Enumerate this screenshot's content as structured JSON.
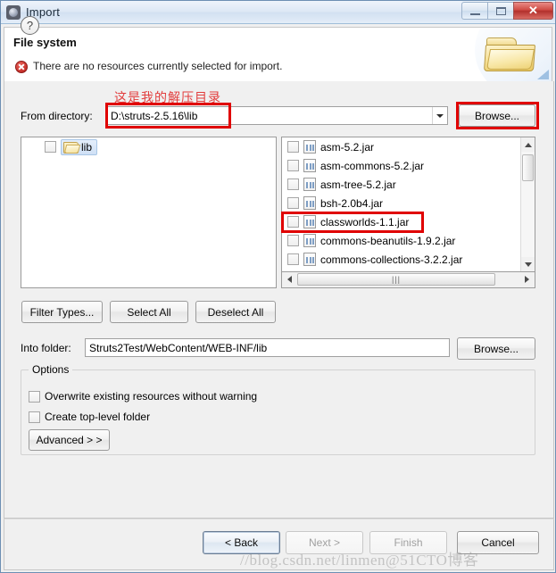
{
  "window": {
    "title": "Import",
    "icon": "import-wizard-icon",
    "controls": {
      "minimize": "minimize",
      "maximize": "maximize",
      "close": "close"
    }
  },
  "header": {
    "title": "File system",
    "message": "There are no resources currently selected for import.",
    "status_icon": "error-icon",
    "banner_icon": "folder-banner-icon"
  },
  "annotation": {
    "note_cn": "这是我的解压目录",
    "note_color": "#e23c3c",
    "highlight_color": "#e00000"
  },
  "source": {
    "label": "From directory:",
    "value": "D:\\struts-2.5.16\\lib",
    "browse_label": "Browse..."
  },
  "tree": {
    "items": [
      {
        "label": "lib",
        "checked": false,
        "selected": true,
        "icon": "folder-icon"
      }
    ]
  },
  "files": {
    "items": [
      {
        "name": "asm-5.2.jar",
        "checked": false,
        "highlighted": false
      },
      {
        "name": "asm-commons-5.2.jar",
        "checked": false,
        "highlighted": false
      },
      {
        "name": "asm-tree-5.2.jar",
        "checked": false,
        "highlighted": false
      },
      {
        "name": "bsh-2.0b4.jar",
        "checked": false,
        "highlighted": false
      },
      {
        "name": "classworlds-1.1.jar",
        "checked": false,
        "highlighted": true
      },
      {
        "name": "commons-beanutils-1.9.2.jar",
        "checked": false,
        "highlighted": false
      },
      {
        "name": "commons-collections-3.2.2.jar",
        "checked": false,
        "highlighted": false
      }
    ]
  },
  "selection_buttons": {
    "filter_types": "Filter Types...",
    "select_all": "Select All",
    "deselect_all": "Deselect All"
  },
  "destination": {
    "label": "Into folder:",
    "value": "Struts2Test/WebContent/WEB-INF/lib",
    "browse_label": "Browse..."
  },
  "options": {
    "legend": "Options",
    "checkboxes": [
      {
        "label": "Overwrite existing resources without warning",
        "checked": false
      },
      {
        "label": "Create top-level folder",
        "checked": false
      }
    ],
    "advanced_label": "Advanced  > >"
  },
  "footer": {
    "help_label": "?",
    "back": {
      "label": "< Back",
      "enabled": true,
      "default": true
    },
    "next": {
      "label": "Next >",
      "enabled": false
    },
    "finish": {
      "label": "Finish",
      "enabled": false
    },
    "cancel": {
      "label": "Cancel",
      "enabled": true
    }
  },
  "watermark": {
    "text": "//blog.csdn.net/linmen@51CTO博客"
  }
}
